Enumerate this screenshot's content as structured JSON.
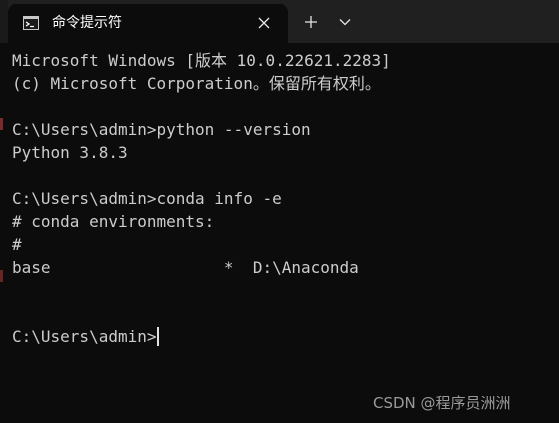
{
  "window": {
    "tab_title": "命令提示符",
    "tab_icon": "terminal-icon",
    "close_icon": "close-icon",
    "new_tab_icon": "plus-icon",
    "dropdown_icon": "chevron-down-icon"
  },
  "terminal": {
    "lines": [
      "Microsoft Windows [版本 10.0.22621.2283]",
      "(c) Microsoft Corporation。保留所有权利。",
      "",
      "C:\\Users\\admin>python --version",
      "Python 3.8.3",
      "",
      "C:\\Users\\admin>conda info -e",
      "# conda environments:",
      "#",
      "base                  *  D:\\Anaconda",
      "",
      "",
      "C:\\Users\\admin>"
    ]
  },
  "watermark": "CSDN @程序员洲洲",
  "colors": {
    "background": "#0c0c0c",
    "tabbar": "#202020",
    "text": "#cccccc",
    "watermark": "#9a9a9a"
  }
}
